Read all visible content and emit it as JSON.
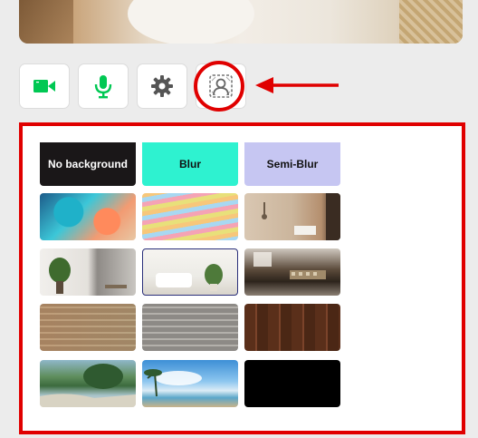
{
  "toolbar": {
    "buttons": [
      {
        "name": "camera-button",
        "icon": "video-camera-icon",
        "color": "#00c853"
      },
      {
        "name": "microphone-button",
        "icon": "microphone-icon",
        "color": "#00c853"
      },
      {
        "name": "settings-button",
        "icon": "gear-icon",
        "color": "#555555"
      },
      {
        "name": "virtual-background-button",
        "icon": "person-background-icon",
        "color": "#777777"
      }
    ]
  },
  "backgrounds": {
    "options": [
      {
        "label": "No background",
        "bg": "#1a1718",
        "fg": "#ffffff"
      },
      {
        "label": "Blur",
        "bg": "#2ef2d0",
        "fg": "#111111"
      },
      {
        "label": "Semi-Blur",
        "bg": "#c6c6f2",
        "fg": "#111111"
      }
    ],
    "images": [
      {
        "name": "abstract-color"
      },
      {
        "name": "wavy-lines"
      },
      {
        "name": "room-lamp"
      },
      {
        "name": "plant-room"
      },
      {
        "name": "living-room",
        "selected": true
      },
      {
        "name": "cafe-interior"
      },
      {
        "name": "painted-brick-wall"
      },
      {
        "name": "gray-brick-wall"
      },
      {
        "name": "wood-panels"
      },
      {
        "name": "tropical-beach"
      },
      {
        "name": "sky-beach"
      },
      {
        "name": "black"
      }
    ]
  },
  "annotation": {
    "color": "#e00000"
  }
}
